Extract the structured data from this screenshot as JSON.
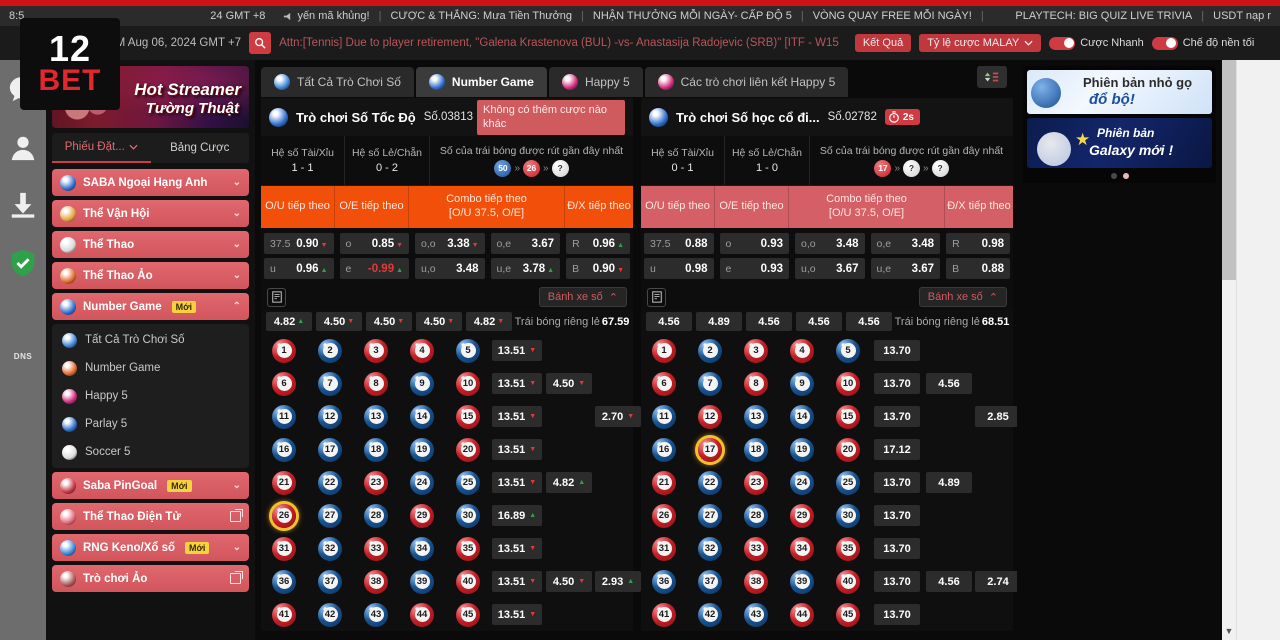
{
  "topbar": {
    "time_left": "8:5",
    "time_right": "24 GMT +8",
    "items": [
      "yến mã khủng!",
      "CƯỢC & THẮNG: Mưa Tiền Thưởng",
      "NHẬN THƯỞNG MỖI NGÀY- CẤP ĐỘ 5",
      "VÒNG QUAY FREE MỖI NGÀY!",
      "PLAYTECH: BIG QUIZ LIVE TRIVIA",
      "USDT nạp r"
    ],
    "separator": "|"
  },
  "bar2": {
    "time": "PM Aug 06, 2024 GMT +7",
    "search_icon": "search-icon",
    "ticker": "Attn:[Tennis] Due to player retirement, \"Galena Krastenova (BUL) -vs- Anastasija Radojevic (SRB)\" [ITF - W15",
    "results_label": "Kết Quả",
    "odds_label": "Tỷ lệ cược MALAY",
    "quick_bet_label": "Cược Nhanh",
    "dark_mode_label": "Chế độ nền tối"
  },
  "logo": {
    "line1": "12",
    "line2": "BET"
  },
  "rail": {
    "items": [
      {
        "name": "info-icon",
        "label": "i"
      },
      {
        "name": "avatar-icon",
        "label": ""
      },
      {
        "name": "download-icon",
        "label": ""
      },
      {
        "name": "dns-shield-icon",
        "label": "DNS"
      }
    ]
  },
  "sidebar": {
    "promo": {
      "title1": "Hot Streamer",
      "title2": "Tường Thuật"
    },
    "tabs": [
      {
        "label": "Phiếu Đặt...",
        "active": true
      },
      {
        "label": "Bảng Cược",
        "active": false
      }
    ],
    "nav": [
      {
        "label": "SABA Ngoại Hạng Anh",
        "icon": "football-badge-icon",
        "chevron": "down",
        "badge": "",
        "color": "#2f6fd0"
      },
      {
        "label": "Thể Vận Hội",
        "icon": "torch-icon",
        "chevron": "down",
        "badge": "",
        "color": "#e3a43c"
      },
      {
        "label": "Thể Thao",
        "icon": "soccer-icon",
        "chevron": "down",
        "badge": "",
        "color": "#d8d8d8"
      },
      {
        "label": "Thể Thao Ảo",
        "icon": "virtual-sports-icon",
        "chevron": "down",
        "badge": "",
        "color": "#e06a2c"
      },
      {
        "label": "Number Game",
        "icon": "number-game-icon",
        "chevron": "up",
        "badge": "Mới",
        "color": "#2f6fd0",
        "active": true
      }
    ],
    "subnav": [
      {
        "label": "Tất Cả Trò Chơi Số",
        "icon": "all-number-games-icon",
        "color": "#3a86d8"
      },
      {
        "label": "Number Game",
        "icon": "number-game-icon",
        "color": "#e06a2c"
      },
      {
        "label": "Happy 5",
        "icon": "happy5-icon",
        "color": "#d12a7c"
      },
      {
        "label": "Parlay 5",
        "icon": "parlay5-icon",
        "color": "#2f6fd0"
      },
      {
        "label": "Soccer 5",
        "icon": "soccer5-icon",
        "color": "#dddddd"
      }
    ],
    "nav2": [
      {
        "label": "Saba PinGoal",
        "icon": "pingoal-icon",
        "chevron": "down",
        "badge": "Mới",
        "color": "#c23a46"
      },
      {
        "label": "Thể Thao Điện Tử",
        "icon": "esports-icon",
        "chevron": "external",
        "badge": "",
        "color": "#e06a7a"
      },
      {
        "label": "RNG Keno/Xổ số",
        "icon": "keno-icon",
        "chevron": "down",
        "badge": "Mới",
        "color": "#3a86d8"
      },
      {
        "label": "Trò chơi Ảo",
        "icon": "virtual-games-icon",
        "chevron": "external",
        "badge": "",
        "color": "#b05a5a"
      }
    ]
  },
  "content": {
    "tabs": [
      {
        "label": "Tất Cả Trò Chơi Số",
        "active": false,
        "icon": "all-number-games-icon",
        "color": "#3a86d8"
      },
      {
        "label": "Number Game",
        "active": true,
        "icon": "number-game-icon",
        "color": "#2f6fd0"
      },
      {
        "label": "Happy 5",
        "active": false,
        "icon": "happy5-icon",
        "color": "#d12a7c"
      },
      {
        "label": "Các trò chơi liên kết Happy 5",
        "active": false,
        "icon": "happy5-link-icon",
        "color": "#d12a7c"
      }
    ],
    "sort_icon": "sort-filter-icon"
  },
  "panels": [
    {
      "title": "Trò chơi Số Tốc Độ",
      "draw_no": "Số.03813",
      "icon": "speed-number-game-icon",
      "alert": "Không có thêm cược nào khác",
      "timer": "",
      "stats": [
        {
          "label": "Hệ số Tài/Xỉu",
          "value": "1 - 1"
        },
        {
          "label": "Hệ số Lẻ/Chẵn",
          "value": "0 - 2"
        }
      ],
      "recent_label": "Số của trái bóng được rút gần đây nhất",
      "recent_balls": [
        {
          "num": "50",
          "color": "b"
        },
        {
          "num": "26",
          "color": "r"
        },
        {
          "num": "?",
          "color": "w"
        }
      ],
      "odds_header": [
        "O/U tiếp theo",
        "O/E tiếp theo",
        "Combo tiếp theo\n[O/U 37.5, O/E]",
        "Đ/X tiếp theo"
      ],
      "header_color": "#f2500a",
      "odds_rows": [
        [
          {
            "k": "37.5",
            "v": "0.90",
            "tick": "dn"
          },
          {
            "k": "o",
            "v": "0.85",
            "tick": "dn"
          },
          {
            "k": "o,o",
            "v": "3.38",
            "tick": "dn"
          },
          {
            "k": "o,e",
            "v": "3.67",
            "tick": ""
          },
          {
            "k": "R",
            "v": "0.96",
            "tick": "up"
          }
        ],
        [
          {
            "k": "u",
            "v": "0.96",
            "tick": "up"
          },
          {
            "k": "e",
            "v": "-0.99",
            "tick": "up",
            "down": true
          },
          {
            "k": "u,o",
            "v": "3.48",
            "tick": ""
          },
          {
            "k": "u,e",
            "v": "3.78",
            "tick": "up"
          },
          {
            "k": "B",
            "v": "0.90",
            "tick": "dn"
          }
        ]
      ],
      "wheel_label": "Bánh xe số",
      "wheel_icon": "bet-slip-icon",
      "col_odds": [
        "4.82",
        "4.50",
        "4.50",
        "4.50",
        "4.82"
      ],
      "col_ticks": [
        "up",
        "dn",
        "dn",
        "dn",
        "dn"
      ],
      "single_ball_label": "Trái bóng riêng lẻ",
      "single_ball_value": "67.59",
      "selected_ball": 26,
      "ball_colors": "rbrrb rbrbr bbbbr bbbbr rbrbb rbbrb rbrbr bbrbr rbbrr",
      "row_odds": [
        {
          "c1": "13.51",
          "t1": "dn",
          "c2": "",
          "t2": "",
          "c3": "",
          "t3": ""
        },
        {
          "c1": "13.51",
          "t1": "dn",
          "c2": "4.50",
          "t2": "dn",
          "c3": "",
          "t3": ""
        },
        {
          "c1": "13.51",
          "t1": "dn",
          "c2": "",
          "t2": "",
          "c3": "2.70",
          "t3": "dn"
        },
        {
          "c1": "13.51",
          "t1": "dn",
          "c2": "",
          "t2": "",
          "c3": "",
          "t3": ""
        },
        {
          "c1": "13.51",
          "t1": "dn",
          "c2": "4.82",
          "t2": "up",
          "c3": "",
          "t3": ""
        },
        {
          "c1": "16.89",
          "t1": "up",
          "c2": "",
          "t2": "",
          "c3": "",
          "t3": ""
        },
        {
          "c1": "13.51",
          "t1": "dn",
          "c2": "",
          "t2": "",
          "c3": "",
          "t3": ""
        },
        {
          "c1": "13.51",
          "t1": "dn",
          "c2": "4.50",
          "t2": "dn",
          "c3": "2.93",
          "t3": "up"
        },
        {
          "c1": "13.51",
          "t1": "dn",
          "c2": "",
          "t2": "",
          "c3": "",
          "t3": ""
        }
      ]
    },
    {
      "title": "Trò chơi Số học cổ đi...",
      "draw_no": "Số.02782",
      "icon": "classic-number-game-icon",
      "alert": "",
      "timer": "2s",
      "timer_icon": "stopwatch-icon",
      "stats": [
        {
          "label": "Hệ số Tài/Xỉu",
          "value": "0 - 1"
        },
        {
          "label": "Hệ số Lẻ/Chẵn",
          "value": "1 - 0"
        }
      ],
      "recent_label": "Số của trái bóng được rút gần đây nhất",
      "recent_balls": [
        {
          "num": "17",
          "color": "r"
        },
        {
          "num": "?",
          "color": "w"
        },
        {
          "num": "?",
          "color": "w"
        }
      ],
      "odds_header": [
        "O/U tiếp theo",
        "O/E tiếp theo",
        "Combo tiếp theo\n[O/U 37.5, O/E]",
        "Đ/X tiếp theo"
      ],
      "header_color": "#d55f66",
      "odds_rows": [
        [
          {
            "k": "37.5",
            "v": "0.88",
            "tick": ""
          },
          {
            "k": "o",
            "v": "0.93",
            "tick": ""
          },
          {
            "k": "o,o",
            "v": "3.48",
            "tick": ""
          },
          {
            "k": "o,e",
            "v": "3.48",
            "tick": ""
          },
          {
            "k": "R",
            "v": "0.98",
            "tick": ""
          }
        ],
        [
          {
            "k": "u",
            "v": "0.98",
            "tick": ""
          },
          {
            "k": "e",
            "v": "0.93",
            "tick": ""
          },
          {
            "k": "u,o",
            "v": "3.67",
            "tick": ""
          },
          {
            "k": "u,e",
            "v": "3.67",
            "tick": ""
          },
          {
            "k": "B",
            "v": "0.88",
            "tick": ""
          }
        ]
      ],
      "wheel_label": "Bánh xe số",
      "wheel_icon": "bet-slip-icon",
      "col_odds": [
        "4.56",
        "4.89",
        "4.56",
        "4.56",
        "4.56"
      ],
      "col_ticks": [
        "",
        "",
        "",
        "",
        ""
      ],
      "single_ball_label": "Trái bóng riêng lẻ",
      "single_ball_value": "68.51",
      "selected_ball": 17,
      "ball_colors": "rbrrb rbrbr brbbr brbbr rbrbb rbbrb rbrrr bbrbr rbbrr",
      "row_odds": [
        {
          "c1": "13.70",
          "t1": "",
          "c2": "",
          "t2": "",
          "c3": "",
          "t3": ""
        },
        {
          "c1": "13.70",
          "t1": "",
          "c2": "4.56",
          "t2": "",
          "c3": "",
          "t3": ""
        },
        {
          "c1": "13.70",
          "t1": "",
          "c2": "",
          "t2": "",
          "c3": "2.85",
          "t3": ""
        },
        {
          "c1": "17.12",
          "t1": "",
          "c2": "",
          "t2": "",
          "c3": "",
          "t3": ""
        },
        {
          "c1": "13.70",
          "t1": "",
          "c2": "4.89",
          "t2": "",
          "c3": "",
          "t3": ""
        },
        {
          "c1": "13.70",
          "t1": "",
          "c2": "",
          "t2": "",
          "c3": "",
          "t3": ""
        },
        {
          "c1": "13.70",
          "t1": "",
          "c2": "",
          "t2": "",
          "c3": "",
          "t3": ""
        },
        {
          "c1": "13.70",
          "t1": "",
          "c2": "4.56",
          "t2": "",
          "c3": "2.74",
          "t3": ""
        },
        {
          "c1": "13.70",
          "t1": "",
          "c2": "",
          "t2": "",
          "c3": "",
          "t3": ""
        }
      ]
    }
  ],
  "right": {
    "banner1": {
      "line1": "Phiên bản nhỏ gọ",
      "line2": "đổ bộ!"
    },
    "banner2": {
      "line1": "Phiên bản",
      "line2": "Galaxy mới !"
    },
    "dots": [
      false,
      true
    ]
  }
}
